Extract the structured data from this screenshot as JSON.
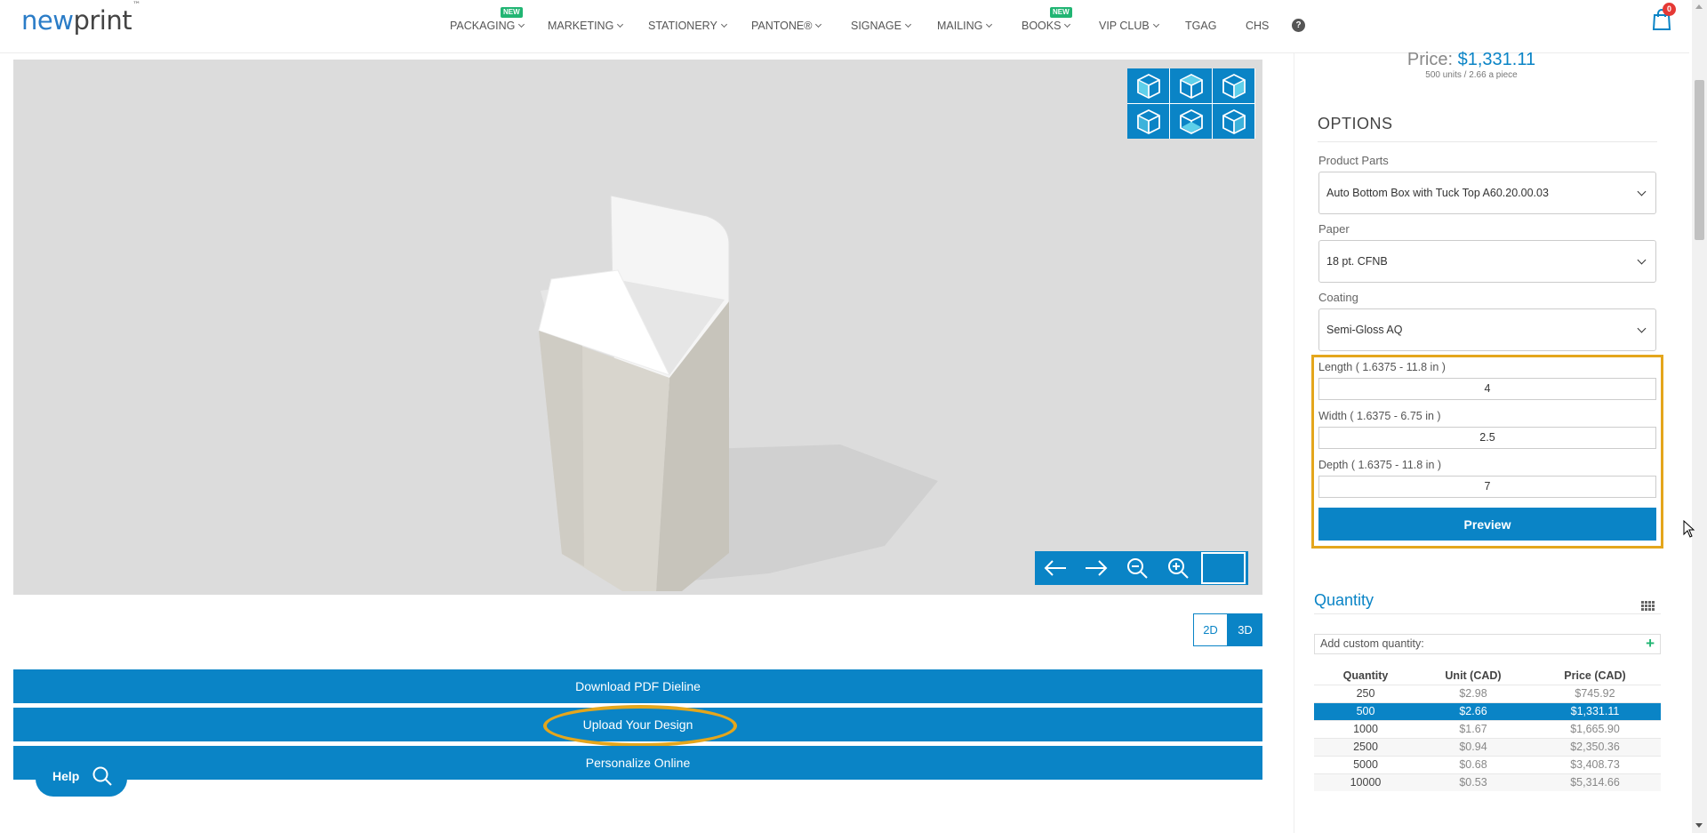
{
  "header": {
    "logo_part1": "new",
    "logo_part2": "print",
    "logo_tm": "™",
    "nav": [
      {
        "label": "PACKAGING",
        "badge": "NEW"
      },
      {
        "label": "MARKETING"
      },
      {
        "label": "STATIONERY"
      },
      {
        "label": "PANTONE®"
      },
      {
        "label": "SIGNAGE"
      },
      {
        "label": "MAILING"
      },
      {
        "label": "BOOKS",
        "badge": "NEW"
      },
      {
        "label": "VIP CLUB"
      },
      {
        "label": "TGAG"
      },
      {
        "label": "CHS"
      }
    ],
    "help_glyph": "?",
    "cart_count": "0"
  },
  "viewer": {
    "view_buttons": [
      "cube-front-icon",
      "cube-back-icon",
      "cube-right-icon",
      "cube-left-icon",
      "cube-top-icon",
      "cube-bottom-icon"
    ],
    "controls": [
      "arrow-left-icon",
      "arrow-right-icon",
      "zoom-out-icon",
      "zoom-in-icon"
    ],
    "toggle_2d": "2D",
    "toggle_3d": "3D",
    "active_mode": "3D"
  },
  "actions": {
    "download": "Download PDF Dieline",
    "upload": "Upload Your Design",
    "personalize": "Personalize Online"
  },
  "help_widget": {
    "label": "Help"
  },
  "pricing": {
    "price_label": "Price:",
    "price_value": "$1,331.11",
    "sub": "500 units / 2.66 a piece"
  },
  "options": {
    "title": "OPTIONS",
    "product_parts_label": "Product Parts",
    "product_parts_value": "Auto Bottom Box with Tuck Top A60.20.00.03",
    "paper_label": "Paper",
    "paper_value": "18 pt. CFNB",
    "coating_label": "Coating",
    "coating_value": "Semi-Gloss AQ",
    "length_label": "Length ( 1.6375 - 11.8 in )",
    "length_value": "4",
    "width_label": "Width ( 1.6375 - 6.75 in )",
    "width_value": "2.5",
    "depth_label": "Depth ( 1.6375 - 11.8 in )",
    "depth_value": "7",
    "preview_label": "Preview"
  },
  "quantity": {
    "title": "Quantity",
    "custom_placeholder": "Add custom quantity:",
    "headers": [
      "Quantity",
      "Unit (CAD)",
      "Price (CAD)"
    ],
    "rows": [
      [
        "250",
        "$2.98",
        "$745.92"
      ],
      [
        "500",
        "$2.66",
        "$1,331.11"
      ],
      [
        "1000",
        "$1.67",
        "$1,665.90"
      ],
      [
        "2500",
        "$0.94",
        "$2,350.36"
      ],
      [
        "5000",
        "$0.68",
        "$3,408.73"
      ],
      [
        "10000",
        "$0.53",
        "$5,314.66"
      ]
    ],
    "selected_quantity": "500"
  },
  "colors": {
    "accent": "#0a84c6",
    "highlight": "#e4a61c",
    "badge": "#21b573"
  }
}
